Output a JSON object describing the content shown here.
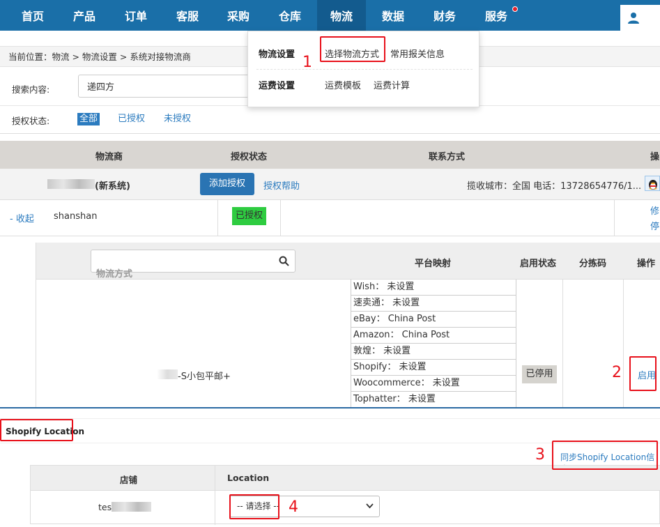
{
  "nav": {
    "items": [
      "首页",
      "产品",
      "订单",
      "客服",
      "采购",
      "仓库",
      "物流",
      "数据",
      "财务",
      "服务"
    ],
    "active": "物流"
  },
  "breadcrumb": "当前位置：物流 > 物流设置 > 系统对接物流商",
  "search": {
    "label": "搜索内容:",
    "value": "递四方",
    "auth_label": "授权状态:",
    "auth_options": [
      "全部",
      "已授权",
      "未授权"
    ],
    "auth_selected": "全部"
  },
  "table": {
    "headers": [
      "物流商",
      "授权状态",
      "联系方式",
      "操"
    ],
    "provider_suffix": "(新系统)",
    "add_auth": "添加授权",
    "auth_help": "授权帮助",
    "contact": "揽收城市：全国  电话：13728654776/1...",
    "collapse": "- 收起",
    "account": "shanshan",
    "account_status": "已授权",
    "action_1": "修",
    "action_2": "停"
  },
  "inner": {
    "search_placeholder": "物流方式",
    "headers": [
      "平台映射",
      "启用状态",
      "分拣码",
      "操作"
    ],
    "method_name": "-S小包平邮+",
    "mappings": [
      "Wish：  未设置",
      "速卖通：  未设置",
      "eBay：  China Post",
      "Amazon：  China Post",
      "敦煌：  未设置",
      "Shopify：  未设置",
      "Woocommerce：  未设置",
      "Tophatter：  未设置"
    ],
    "status": "已停用",
    "enable": "启用"
  },
  "shopify": {
    "title": "Shopify Location",
    "sync": "同步Shopify Location信息",
    "headers": [
      "店铺",
      "Location"
    ],
    "store": "test",
    "select_placeholder": "-- 请选择 --"
  },
  "dropdown": {
    "row1_head": "物流设置",
    "row1_items": [
      "选择物流方式",
      "常用报关信息"
    ],
    "row2_head": "运费设置",
    "row2_items": [
      "运费模板",
      "运费计算"
    ]
  },
  "annotations": [
    "1",
    "2",
    "3",
    "4"
  ],
  "colors": {
    "nav": "#1a6fa8",
    "nav_active": "#135b8e",
    "accent": "#2b7bbf",
    "annotation": "#e8101a",
    "authorized": "#2ecc40"
  }
}
